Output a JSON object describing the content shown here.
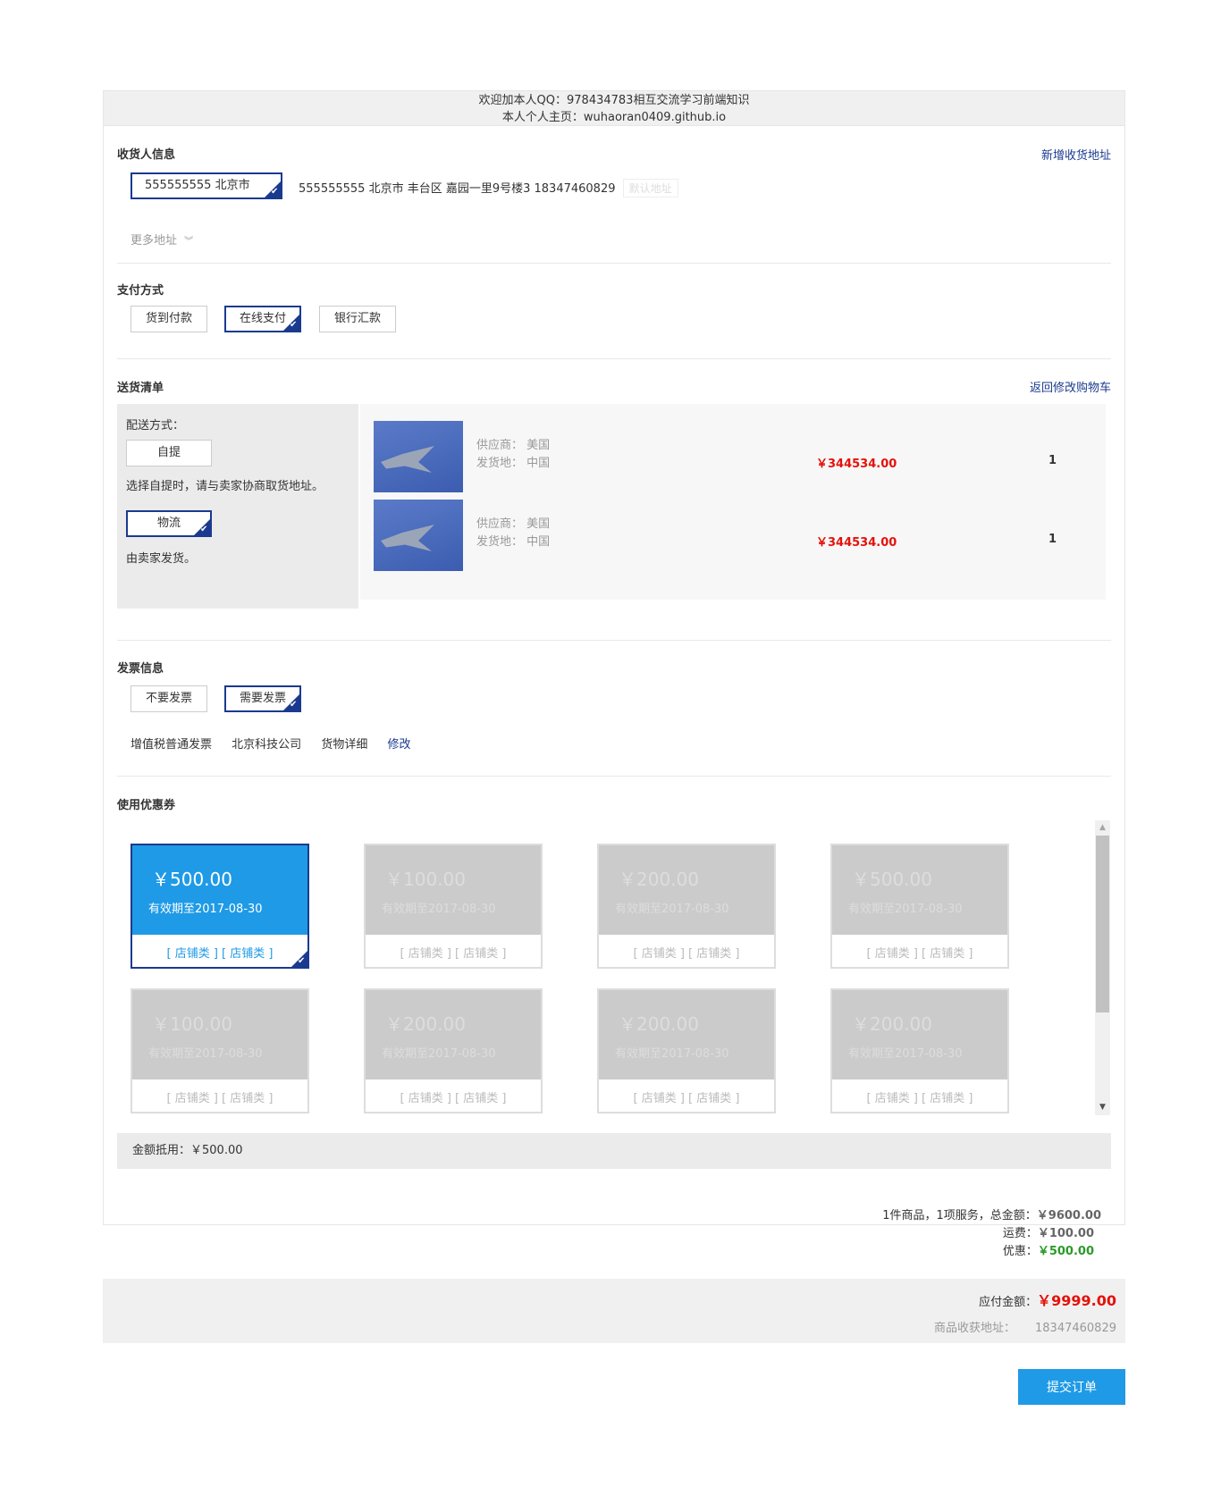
{
  "notice": {
    "line1": "欢迎加本人QQ：978434783相互交流学习前端知识",
    "line2": "本人个人主页：wuhaoran0409.github.io"
  },
  "receiver": {
    "title": "收货人信息",
    "add_link": "新增收货地址",
    "selected": "555555555 北京市",
    "address": "555555555 北京市 丰台区 嘉园一里9号楼3 18347460829",
    "default_tag": "默认地址",
    "more": "更多地址"
  },
  "payment": {
    "title": "支付方式",
    "options": [
      "货到付款",
      "在线支付",
      "银行汇款"
    ],
    "selected": 1
  },
  "delivery": {
    "title": "送货清单",
    "back_link": "返回修改购物车",
    "method_label": "配送方式：",
    "pickup": "自提",
    "pickup_desc": "选择自提时，请与卖家协商取货地址。",
    "logistics": "物流",
    "logistics_desc": "由卖家发货。",
    "items": [
      {
        "supplier_label": "供应商：",
        "supplier": "美国",
        "origin_label": "发货地：",
        "origin": "中国",
        "price": "￥344534.00",
        "qty": "1"
      },
      {
        "supplier_label": "供应商：",
        "supplier": "美国",
        "origin_label": "发货地：",
        "origin": "中国",
        "price": "￥344534.00",
        "qty": "1"
      }
    ]
  },
  "invoice": {
    "title": "发票信息",
    "options": [
      "不要发票",
      "需要发票"
    ],
    "selected": 1,
    "type": "增值税普通发票",
    "company": "北京科技公司",
    "detail": "货物详细",
    "edit": "修改"
  },
  "coupons": {
    "title": "使用优惠券",
    "items": [
      {
        "amount": "￥500.00",
        "expiry": "有效期至2017-08-30",
        "tag": "[ 店铺类 ] [ 店铺类 ]",
        "active": true
      },
      {
        "amount": "￥100.00",
        "expiry": "有效期至2017-08-30",
        "tag": "[ 店铺类 ] [ 店铺类 ]",
        "active": false
      },
      {
        "amount": "￥200.00",
        "expiry": "有效期至2017-08-30",
        "tag": "[ 店铺类 ] [ 店铺类 ]",
        "active": false
      },
      {
        "amount": "￥500.00",
        "expiry": "有效期至2017-08-30",
        "tag": "[ 店铺类 ] [ 店铺类 ]",
        "active": false
      },
      {
        "amount": "￥100.00",
        "expiry": "有效期至2017-08-30",
        "tag": "[ 店铺类 ] [ 店铺类 ]",
        "active": false
      },
      {
        "amount": "￥200.00",
        "expiry": "有效期至2017-08-30",
        "tag": "[ 店铺类 ] [ 店铺类 ]",
        "active": false
      },
      {
        "amount": "￥200.00",
        "expiry": "有效期至2017-08-30",
        "tag": "[ 店铺类 ] [ 店铺类 ]",
        "active": false
      },
      {
        "amount": "￥200.00",
        "expiry": "有效期至2017-08-30",
        "tag": "[ 店铺类 ] [ 店铺类 ]",
        "active": false
      }
    ],
    "discount_label": "金额抵用：",
    "discount_value": "￥500.00"
  },
  "summary": {
    "total_label": "1件商品，1项服务，总金额：",
    "total": "￥9600.00",
    "shipping_label": "运费：",
    "shipping": "￥100.00",
    "discount_label": "优惠：",
    "discount": "￥500.00"
  },
  "pay": {
    "due_label": "应付金额：",
    "due": "￥9999.00",
    "addr_label": "商品收获地址：",
    "addr": "18347460829"
  },
  "submit_label": "提交订单",
  "colors": {
    "accent": "#1f9ae6",
    "navy": "#1a3a8f",
    "price": "#e4120b",
    "discount": "#2a9a2a"
  }
}
